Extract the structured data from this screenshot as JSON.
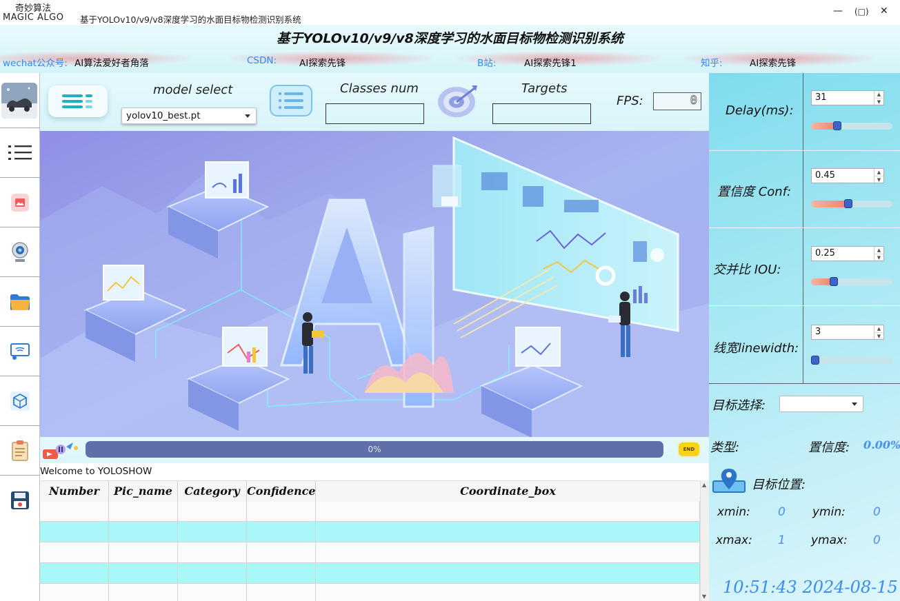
{
  "window": {
    "brand_cn": "奇妙算法",
    "brand_en": "MAGIC  ALGO",
    "title": "基于YOLOv10/v9/v8深度学习的水面目标物检测识别系统",
    "minimize": "—",
    "restore": "(□)",
    "close": "✕"
  },
  "header": {
    "title": "基于YOLOv10/v9/v8深度学习的水面目标物检测识别系统",
    "wechat_label": "wechat公众号:",
    "wechat_value": "AI算法爱好者角落",
    "csdn_label": "CSDN:",
    "csdn_value": "AI探索先锋",
    "bilibili_label": "B站:",
    "bilibili_value": "AI探索先锋1",
    "zhihu_label": "知乎:",
    "zhihu_value": "AI探索先锋"
  },
  "sidebar": {
    "items": [
      {
        "icon": "avatar"
      },
      {
        "icon": "menu-icon"
      },
      {
        "icon": "image-icon"
      },
      {
        "icon": "webcam-icon"
      },
      {
        "icon": "folder-icon"
      },
      {
        "icon": "screen-cast-icon"
      },
      {
        "icon": "model-cube-icon"
      },
      {
        "icon": "clipboard-icon"
      },
      {
        "icon": "save-icon"
      }
    ]
  },
  "controls": {
    "model_select_label": "model select",
    "model_selected": "yolov10_best.pt",
    "classes_label": "Classes num",
    "classes_value": "",
    "targets_label": "Targets",
    "targets_value": "",
    "fps_label": "FPS:",
    "fps_value": "0"
  },
  "progress": {
    "percent": 0,
    "text": "0%",
    "end_label": "END"
  },
  "status": {
    "welcome": "Welcome to YOLOSHOW"
  },
  "table": {
    "columns": [
      "Number",
      "Pic_name",
      "Category",
      "Confidence",
      "Coordinate_box"
    ],
    "rows": [
      [
        "",
        "",
        "",
        "",
        ""
      ],
      [
        "",
        "",
        "",
        "",
        ""
      ],
      [
        "",
        "",
        "",
        "",
        ""
      ],
      [
        "",
        "",
        "",
        "",
        ""
      ],
      [
        "",
        "",
        "",
        "",
        ""
      ]
    ],
    "alt_row_color": "#a9f7f7"
  },
  "settings": {
    "delay_label": "Delay(ms):",
    "delay_value": "31",
    "delay_fraction": 0.3,
    "conf_label": "置信度  Conf:",
    "conf_value": "0.45",
    "conf_fraction": 0.45,
    "iou_label": "交并比   IOU:",
    "iou_value": "0.25",
    "iou_fraction": 0.25,
    "linewidth_label": "线宽linewidth:",
    "linewidth_value": "3",
    "linewidth_fraction": 0.0
  },
  "target": {
    "select_label": "目标选择:",
    "select_value": "",
    "type_label": "类型:",
    "conf_label": "置信度:",
    "conf_value": "0.00%",
    "position_label": "目标位置:",
    "xmin_label": "xmin:",
    "xmin_value": "0",
    "ymin_label": "ymin:",
    "ymin_value": "0",
    "xmax_label": "xmax:",
    "xmax_value": "1",
    "ymax_label": "ymax:",
    "ymax_value": "0"
  },
  "clock": "10:51:43 2024-08-15",
  "colors": {
    "accent_blue": "#2f8cf0",
    "value_blue": "#4d8ef0",
    "progress_bar": "#5f6fa8",
    "end_button": "#f7d31a",
    "slider_fill": "#ef7f6b",
    "slider_knob": "#3d65c7"
  }
}
